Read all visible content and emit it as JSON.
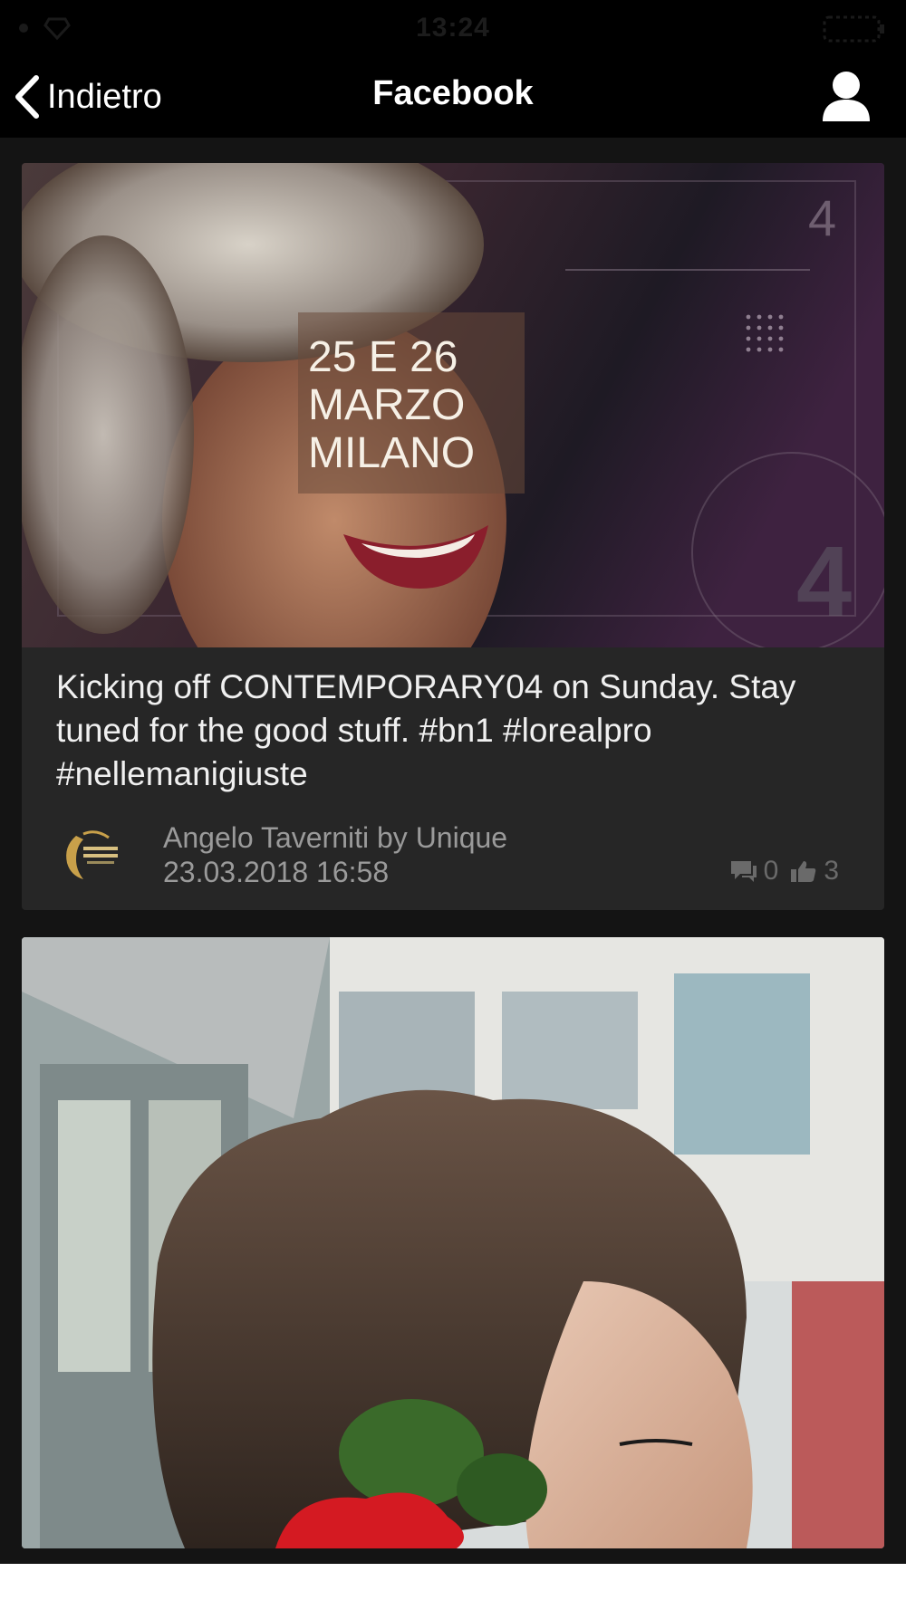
{
  "status_bar": {
    "time": "13:24"
  },
  "nav": {
    "back_label": "Indietro",
    "title": "Facebook"
  },
  "posts": [
    {
      "image_overlay": {
        "line1": "25 E 26",
        "line2": "MARZO",
        "line3": "MILANO",
        "corner_number": "4"
      },
      "text": "Kicking off CONTEMPORARY04 on Sunday. Stay tuned for the good stuff. #bn1 #lorealpro #nellemanigiuste",
      "author": "Angelo Taverniti by Unique",
      "date": "23.03.2018 16:58",
      "comments": "0",
      "likes": "3"
    },
    {
      "image_alt": "updo hairstyle with red rose"
    }
  ],
  "colors": {
    "background": "#141414",
    "card": "#262626",
    "bar": "#000000",
    "meta_text": "#9a9a9a"
  },
  "icons": [
    "chevron-left-icon",
    "user-icon",
    "comment-icon",
    "thumbs-up-icon"
  ]
}
